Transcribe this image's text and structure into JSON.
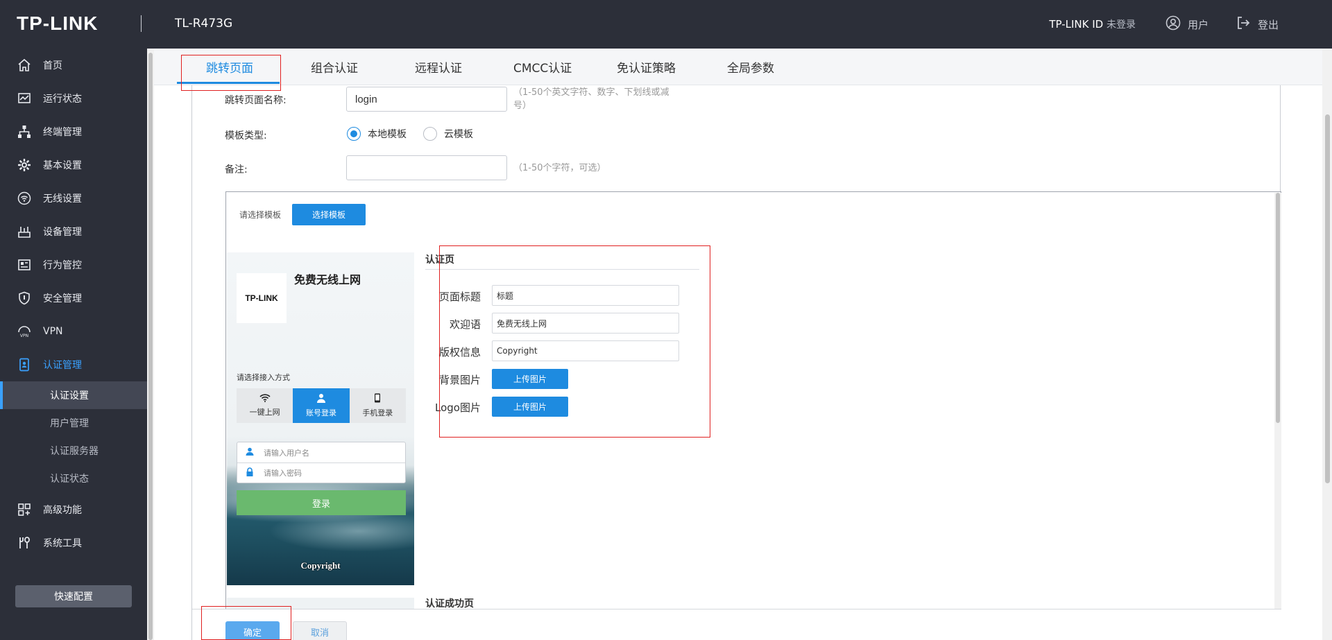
{
  "header": {
    "logo": "TP-LINK",
    "model": "TL-R473G",
    "account_label": "TP-LINK ID",
    "account_status": "未登录",
    "user_label": "用户",
    "logout_label": "登出"
  },
  "sidebar": {
    "items": [
      {
        "label": "首页",
        "icon": "home-icon"
      },
      {
        "label": "运行状态",
        "icon": "monitor-icon"
      },
      {
        "label": "终端管理",
        "icon": "network-icon"
      },
      {
        "label": "基本设置",
        "icon": "gear-icon"
      },
      {
        "label": "无线设置",
        "icon": "wifi-icon"
      },
      {
        "label": "设备管理",
        "icon": "device-icon"
      },
      {
        "label": "行为管控",
        "icon": "behavior-icon"
      },
      {
        "label": "安全管理",
        "icon": "shield-icon"
      },
      {
        "label": "VPN",
        "icon": "vpn-icon"
      },
      {
        "label": "认证管理",
        "icon": "auth-icon"
      },
      {
        "label": "高级功能",
        "icon": "advanced-icon"
      },
      {
        "label": "系统工具",
        "icon": "tools-icon"
      }
    ],
    "sub_items": [
      "认证设置",
      "用户管理",
      "认证服务器",
      "认证状态"
    ],
    "active_item": "认证管理",
    "active_sub": "认证设置",
    "quick_config_label": "快速配置"
  },
  "tabs": [
    "跳转页面",
    "组合认证",
    "远程认证",
    "CMCC认证",
    "免认证策略",
    "全局参数"
  ],
  "active_tab": "跳转页面",
  "form": {
    "name_label": "跳转页面名称:",
    "name_value": "login",
    "name_hint": "（1-50个英文字符、数字、下划线或减号）",
    "type_label": "模板类型:",
    "type_options": [
      "本地模板",
      "云模板"
    ],
    "type_selected": "本地模板",
    "note_label": "备注:",
    "note_value": "",
    "note_hint": "（1-50个字符，可选）"
  },
  "template": {
    "choose_label": "请选择模板",
    "choose_button": "选择模板"
  },
  "preview": {
    "logo_text": "TP-LINK",
    "welcome": "免费无线上网",
    "choose_method": "请选择接入方式",
    "methods": [
      "一键上网",
      "账号登录",
      "手机登录"
    ],
    "active_method": "账号登录",
    "username_placeholder": "请输入用户名",
    "password_placeholder": "请输入密码",
    "login_button": "登录",
    "copyright": "Copyright"
  },
  "auth_page": {
    "section_title": "认证页",
    "title_label": "页面标题",
    "title_value": "标题",
    "welcome_label": "欢迎语",
    "welcome_value": "免费无线上网",
    "copyright_label": "版权信息",
    "copyright_value": "Copyright",
    "bg_label": "背景图片",
    "logo_label": "Logo图片",
    "upload_button": "上传图片"
  },
  "success_section_title": "认证成功页",
  "footer": {
    "confirm": "确定",
    "cancel": "取消"
  },
  "colors": {
    "accent": "#1e8be0",
    "header_bg": "#2c2f39",
    "annotation": "#e02020",
    "login_green": "#6ab96e"
  }
}
